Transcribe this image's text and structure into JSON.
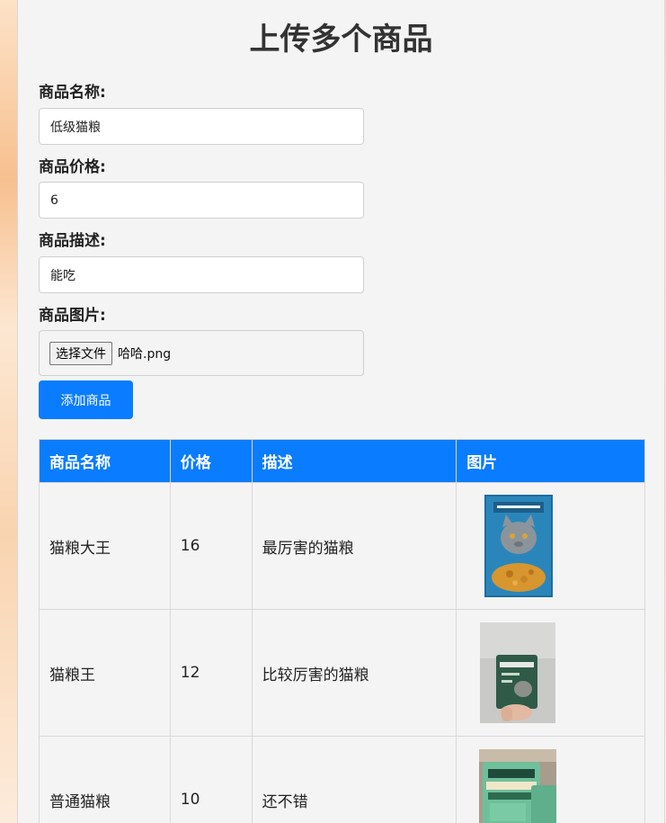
{
  "page": {
    "title": "上传多个商品"
  },
  "form": {
    "name_label": "商品名称:",
    "name_value": "低级猫粮",
    "price_label": "商品价格:",
    "price_value": "6",
    "desc_label": "商品描述:",
    "desc_value": "能吃",
    "image_label": "商品图片:",
    "file_button": "选择文件",
    "file_name": "哈哈.png",
    "submit_label": "添加商品"
  },
  "table": {
    "headers": [
      "商品名称",
      "价格",
      "描述",
      "图片"
    ],
    "rows": [
      {
        "name": "猫粮大王",
        "price": "16",
        "desc": "最厉害的猫粮",
        "image": "blue-cat-food-bag-image"
      },
      {
        "name": "猫粮王",
        "price": "12",
        "desc": "比较厉害的猫粮",
        "image": "hand-holding-cat-food-pouch-image"
      },
      {
        "name": "普通猫粮",
        "price": "10",
        "desc": "还不错",
        "image": "green-cat-food-bags-image"
      }
    ]
  },
  "colors": {
    "accent": "#0a7cff",
    "card_bg": "#f4f4f4"
  }
}
